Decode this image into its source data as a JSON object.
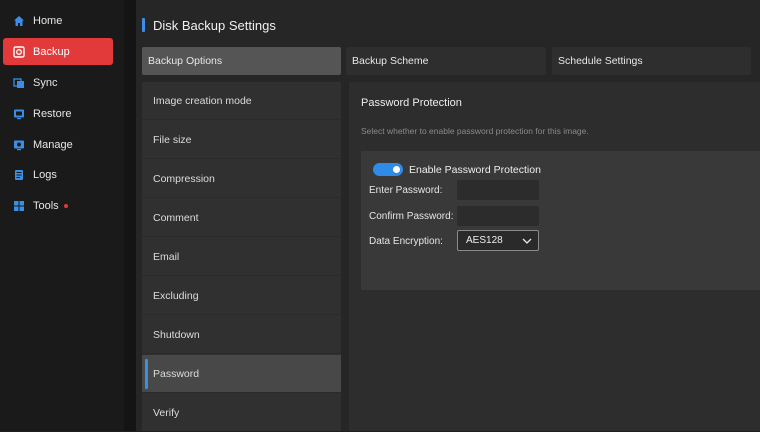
{
  "sidebar": {
    "items": [
      {
        "label": "Home",
        "icon": "home-icon"
      },
      {
        "label": "Backup",
        "icon": "backup-icon",
        "active": true
      },
      {
        "label": "Sync",
        "icon": "sync-icon"
      },
      {
        "label": "Restore",
        "icon": "restore-icon"
      },
      {
        "label": "Manage",
        "icon": "manage-icon"
      },
      {
        "label": "Logs",
        "icon": "logs-icon"
      },
      {
        "label": "Tools",
        "icon": "tools-icon",
        "badge_dot": true
      }
    ]
  },
  "header": {
    "title": "Disk Backup Settings"
  },
  "tabs": [
    {
      "label": "Backup Options",
      "active": true
    },
    {
      "label": "Backup Scheme"
    },
    {
      "label": "Schedule Settings"
    }
  ],
  "options": {
    "items": [
      {
        "label": "Image creation mode"
      },
      {
        "label": "File size"
      },
      {
        "label": "Compression"
      },
      {
        "label": "Comment"
      },
      {
        "label": "Email"
      },
      {
        "label": "Excluding"
      },
      {
        "label": "Shutdown"
      },
      {
        "label": "Password",
        "active": true
      },
      {
        "label": "Verify"
      }
    ]
  },
  "password_panel": {
    "title": "Password Protection",
    "description": "Select whether to enable password protection for this image.",
    "toggle_label": "Enable Password Protection",
    "toggle_on": true,
    "enter_password_label": "Enter Password:",
    "enter_password_value": "",
    "confirm_password_label": "Confirm Password:",
    "confirm_password_value": "",
    "encryption_label": "Data Encryption:",
    "encryption_value": "AES128"
  },
  "colors": {
    "accent_red": "#e23a3a",
    "accent_blue": "#3a8ee6",
    "toggle_blue": "#2f8be6"
  }
}
